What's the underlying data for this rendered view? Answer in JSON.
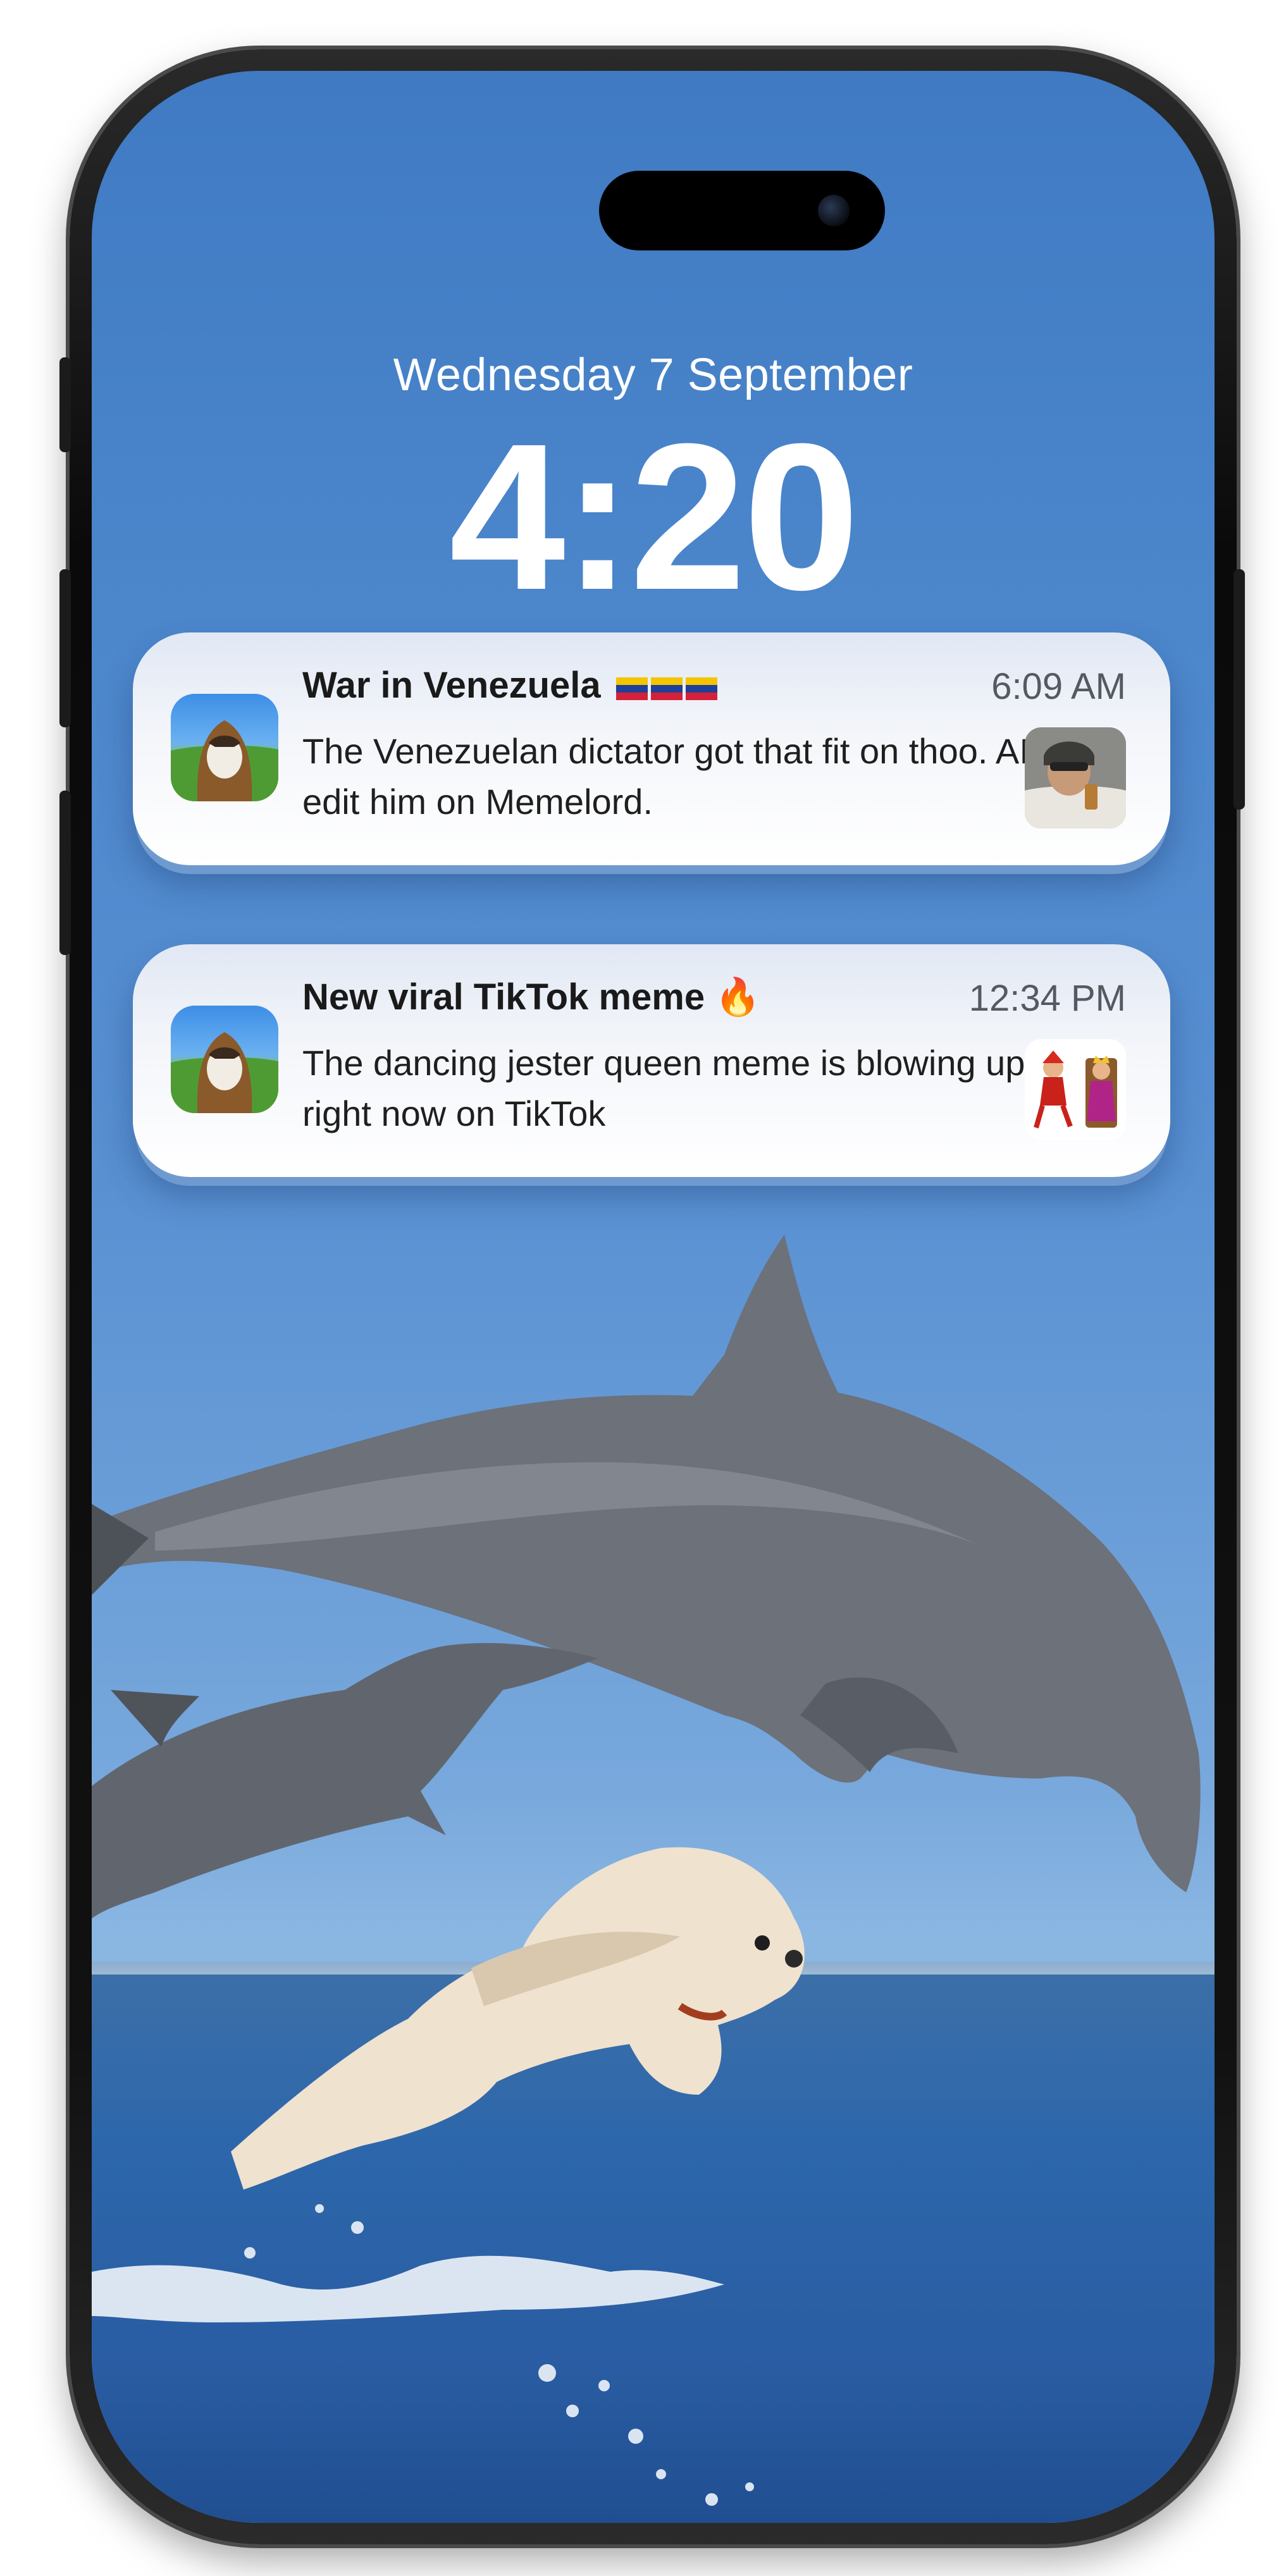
{
  "lock_screen": {
    "date": "Wednesday 7 September",
    "time": "4:20"
  },
  "notifications": [
    {
      "title": "War in Venezuela",
      "title_emoji": "venezuela-flag x3",
      "time": "6:09 AM",
      "body": "The Venezuelan dictator got that fit on thoo. AI edit him on Memelord.",
      "thumbnail": "military-portrait-thumbnail"
    },
    {
      "title": "New viral TikTok meme",
      "title_emoji": "🔥",
      "time": "12:34 PM",
      "body": "The dancing jester queen meme is blowing up right now on TikTok",
      "thumbnail": "jester-queen-thumbnail"
    }
  ],
  "wallpaper": {
    "description_icons": [
      "dolphin-large",
      "dolphin-small",
      "flying-dog",
      "sea"
    ]
  },
  "colors": {
    "sky": "#4883c9",
    "sea": "#2a5da3",
    "card": "#f4f6fa",
    "text": "#1a1a1a"
  }
}
